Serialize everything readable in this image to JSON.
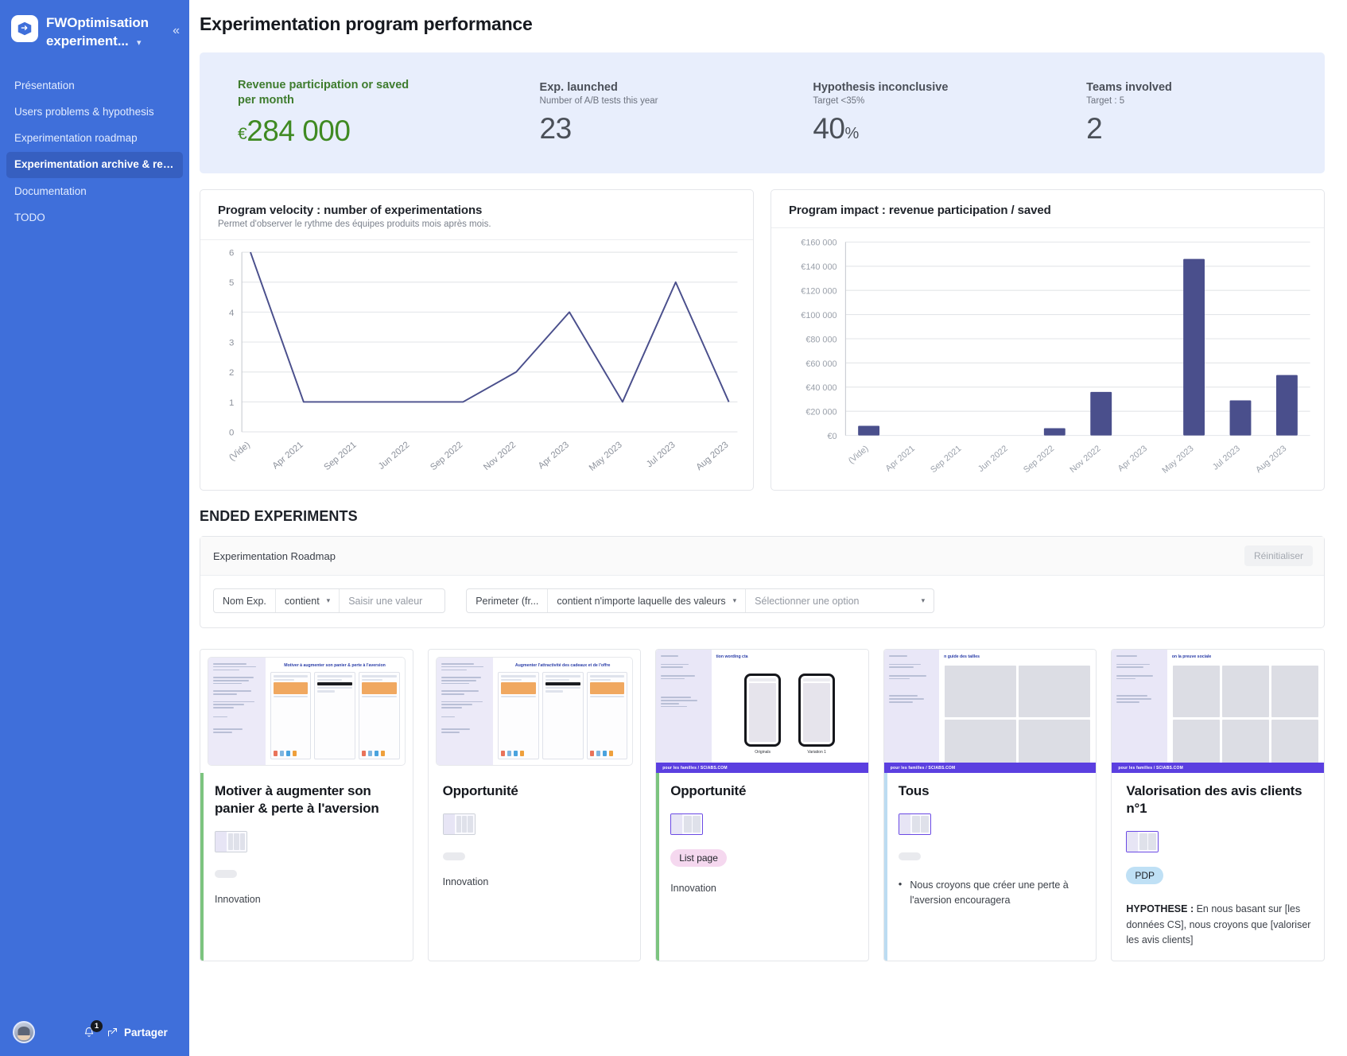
{
  "sidebar": {
    "workspace_title": "FWOptimisation experiment...",
    "logo_icon": "box-arrow-icon",
    "chevron_icon": "chevron-down-icon",
    "collapse_icon": "chevron-double-left-icon",
    "items": [
      {
        "label": "Présentation",
        "active": false
      },
      {
        "label": "Users problems & hypothesis",
        "active": false
      },
      {
        "label": "Experimentation roadmap",
        "active": false
      },
      {
        "label": "Experimentation archive & res...",
        "active": true
      },
      {
        "label": "Documentation",
        "active": false
      },
      {
        "label": "TODO",
        "active": false
      }
    ],
    "footer": {
      "avatar_name": "avatar",
      "bell_icon": "bell-icon",
      "notification_count": "1",
      "share_icon": "share-arrow-icon",
      "share_label": "Partager"
    }
  },
  "header": {
    "title": "Experimentation program performance"
  },
  "kpis": [
    {
      "label": "Revenue participation or saved per month",
      "sub": "",
      "currency": "€",
      "value": "284 000",
      "suffix": "",
      "color": "#3f8a22"
    },
    {
      "label": "Exp. launched",
      "sub": "Number of A/B tests this year",
      "currency": "",
      "value": "23",
      "suffix": "",
      "color": "#4b5058"
    },
    {
      "label": "Hypothesis inconclusive",
      "sub": "Target <35%",
      "currency": "",
      "value": "40",
      "suffix": "%",
      "color": "#4b5058"
    },
    {
      "label": "Teams involved",
      "sub": "Target : 5",
      "currency": "",
      "value": "2",
      "suffix": "",
      "color": "#4b5058"
    }
  ],
  "chart_data": [
    {
      "type": "line",
      "title": "Program velocity : number of experimentations",
      "subtitle": "Permet d'observer le rythme des équipes produits mois après mois.",
      "xlabel": "",
      "ylabel": "",
      "categories": [
        "(Vide)",
        "Apr 2021",
        "Sep 2021",
        "Jun 2022",
        "Sep 2022",
        "Nov 2022",
        "Apr 2023",
        "May 2023",
        "Jul 2023",
        "Aug 2023"
      ],
      "values": [
        6,
        1,
        1,
        1,
        1,
        2,
        4,
        1,
        5,
        1
      ],
      "yticks": [
        0,
        1,
        2,
        3,
        4,
        5,
        6
      ],
      "ylim": [
        0,
        6
      ],
      "grid": true,
      "legend": "none",
      "series_color": "#4a4f8c"
    },
    {
      "type": "bar",
      "title": "Program impact : revenue participation / saved",
      "subtitle": "",
      "xlabel": "",
      "ylabel": "",
      "categories": [
        "(Vide)",
        "Apr 2021",
        "Sep 2021",
        "Jun 2022",
        "Sep 2022",
        "Nov 2022",
        "Apr 2023",
        "May 2023",
        "Jul 2023",
        "Aug 2023"
      ],
      "values": [
        8000,
        0,
        0,
        0,
        6000,
        36000,
        0,
        146000,
        29000,
        50000
      ],
      "yticks": [
        0,
        20000,
        40000,
        60000,
        80000,
        100000,
        120000,
        140000,
        160000
      ],
      "yticklabels": [
        "€0",
        "€20 000",
        "€40 000",
        "€60 000",
        "€80 000",
        "€100 000",
        "€120 000",
        "€140 000",
        "€160 000"
      ],
      "ylim": [
        0,
        160000
      ],
      "grid": true,
      "legend": "none",
      "series_color": "#4a4f8c"
    }
  ],
  "ended": {
    "section_title": "ENDED EXPERIMENTS",
    "filter_card_title": "Experimentation Roadmap",
    "reset_label": "Réinitialiser",
    "filters": [
      {
        "field_label": "Nom Exp.",
        "operator": "contient",
        "operator_caret": "chevron-down-icon",
        "value": "",
        "value_placeholder": "Saisir une valeur"
      },
      {
        "field_label": "Perimeter (fr...",
        "operator": "contient n'importe laquelle des valeurs",
        "operator_caret": "chevron-down-icon",
        "value": "",
        "value_placeholder": "Sélectionner une option"
      }
    ]
  },
  "experiments": [
    {
      "title": "Motiver à augmenter son panier & perte à l'aversion",
      "accent": "#7cc47f",
      "cover_heading": "Motiver à augmenter son panier & perte à l'aversion",
      "cover_type": "doc",
      "thumb": "thumbnail-plain",
      "pill": "",
      "pill_style": "",
      "tag": "Innovation",
      "bullet": "",
      "hypothesis_label": "",
      "hypothesis_text": ""
    },
    {
      "title": "Opportunité",
      "accent": "transparent",
      "cover_heading": "Augmenter l'attractivité des cadeaux et de l'offre",
      "cover_type": "doc",
      "thumb": "thumbnail-plain",
      "pill": "",
      "pill_style": "",
      "tag": "Innovation",
      "bullet": "",
      "hypothesis_label": "",
      "hypothesis_text": ""
    },
    {
      "title": "Opportunité",
      "accent": "#7cc47f",
      "cover_heading": "tion wording cta",
      "cover_type": "phones",
      "cover_caption_a": "Originals",
      "cover_caption_b": "Variation 1",
      "cover_footer": "pour les familles / SCIABS.COM",
      "thumb": "thumbnail-phones",
      "pill": "List page",
      "pill_style": "pink",
      "tag": "Innovation",
      "bullet": "",
      "hypothesis_label": "",
      "hypothesis_text": ""
    },
    {
      "title": "Tous",
      "accent": "#bcdcf2",
      "cover_heading": "n guide des tailles",
      "cover_type": "grid",
      "cover_footer": "pour les familles / SCIABS.COM",
      "thumb": "thumbnail-grid",
      "pill": "",
      "pill_style": "",
      "tag": "",
      "bullet": "Nous croyons que créer une perte à l'aversion encouragera",
      "hypothesis_label": "",
      "hypothesis_text": ""
    },
    {
      "title": "Valorisation des avis clients n°1",
      "accent": "transparent",
      "cover_heading": "on la preuve sociale",
      "cover_type": "grid",
      "cover_footer": "pour les familles / SCIABS.COM",
      "thumb": "thumbnail-reviews",
      "pill": "PDP",
      "pill_style": "blue",
      "tag": "",
      "bullet": "",
      "hypothesis_label": "HYPOTHESE :",
      "hypothesis_text": " En nous basant sur [les données CS], nous croyons que [valoriser les avis clients]"
    }
  ]
}
